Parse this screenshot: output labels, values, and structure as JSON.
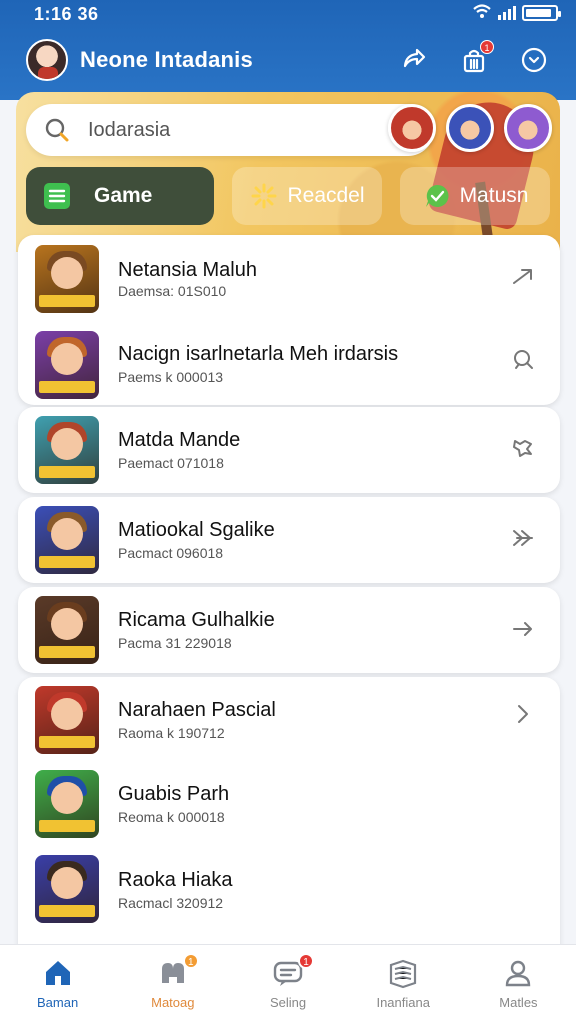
{
  "status_bar": {
    "time": "1:16 36"
  },
  "header": {
    "title": "Neone Intadanis",
    "bag_badge": "1"
  },
  "search": {
    "placeholder": "Iodarasia"
  },
  "categories": [
    {
      "label": "Game",
      "active": true,
      "icon": "menu-icon",
      "color": "#3fbf4f"
    },
    {
      "label": "Reacdel",
      "active": false,
      "icon": "sparkle-icon",
      "color": "#ffd54a"
    },
    {
      "label": "Matusn",
      "active": false,
      "icon": "chat-icon",
      "color": "#5cc24a"
    }
  ],
  "games": [
    {
      "title": "Netansia Maluh",
      "subtitle": "Daemsa: 01S010",
      "action_icon": "arrow-right-icon",
      "hair": "#7a4a22",
      "bg": "#b8741e"
    },
    {
      "title": "Nacign isarlnetarla Meh irdarsis",
      "subtitle": "Paems k 000013",
      "action_icon": "search-icon",
      "hair": "#c0662b",
      "bg": "#7b3fa8"
    },
    {
      "title": "Matda Mande",
      "subtitle": "Paemact 071018",
      "action_icon": "settings-icon",
      "hair": "#b0452a",
      "bg": "#3fa0b0"
    },
    {
      "title": "Matiookal Sgalike",
      "subtitle": "Pacmact 096018",
      "action_icon": "double-chevron-icon",
      "hair": "#8a5a2a",
      "bg": "#3b4fb8"
    },
    {
      "title": "Ricama Gulhalkie",
      "subtitle": "Pacma 31 229018",
      "action_icon": "arrow-right-icon",
      "hair": "#6a3d1e",
      "bg": "#5a3a28"
    },
    {
      "title": "Narahaen Pascial",
      "subtitle": "Raoma k 190712",
      "action_icon": "chevron-right-icon",
      "hair": "#c0392b",
      "bg": "#c0392b"
    },
    {
      "title": "Guabis Parh",
      "subtitle": "Reoma k 000018",
      "action_icon": "",
      "hair": "#1f4fa8",
      "bg": "#3fae4a"
    },
    {
      "title": "Raoka Hiaka",
      "subtitle": "Racmacl 320912",
      "action_icon": "",
      "hair": "#3a2a1e",
      "bg": "#3a3fa8"
    }
  ],
  "bottom_nav": [
    {
      "label": "Baman",
      "icon": "home-icon",
      "badge": ""
    },
    {
      "label": "Matoag",
      "icon": "controller-icon",
      "badge": "1"
    },
    {
      "label": "Seling",
      "icon": "message-icon",
      "badge": "1"
    },
    {
      "label": "Inanfiana",
      "icon": "book-icon",
      "badge": ""
    },
    {
      "label": "Matles",
      "icon": "profile-icon",
      "badge": ""
    }
  ]
}
